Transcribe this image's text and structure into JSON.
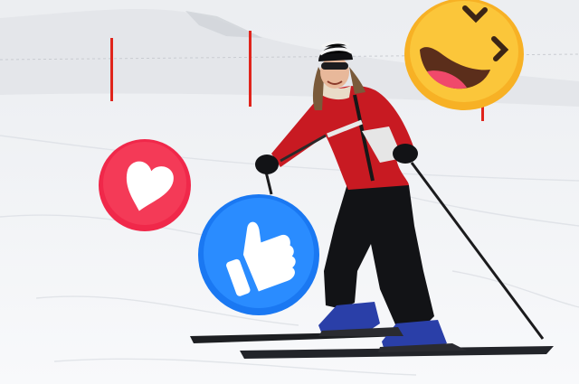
{
  "scene": {
    "subject": "skier",
    "setting": "snowy ski slope",
    "reactions": [
      {
        "icon": "heart-icon",
        "color": "#f0284a"
      },
      {
        "icon": "thumbs-up-icon",
        "color": "#1a78f2"
      },
      {
        "icon": "laughing-face-icon",
        "color": "#f7b125"
      }
    ]
  },
  "colors": {
    "sky": "#f1f2f4",
    "snow": "#f6f7f9",
    "jacket": "#c81a22",
    "pants": "#111214",
    "boots": "#2a3fa8",
    "pole_marker": "#e0241c"
  }
}
